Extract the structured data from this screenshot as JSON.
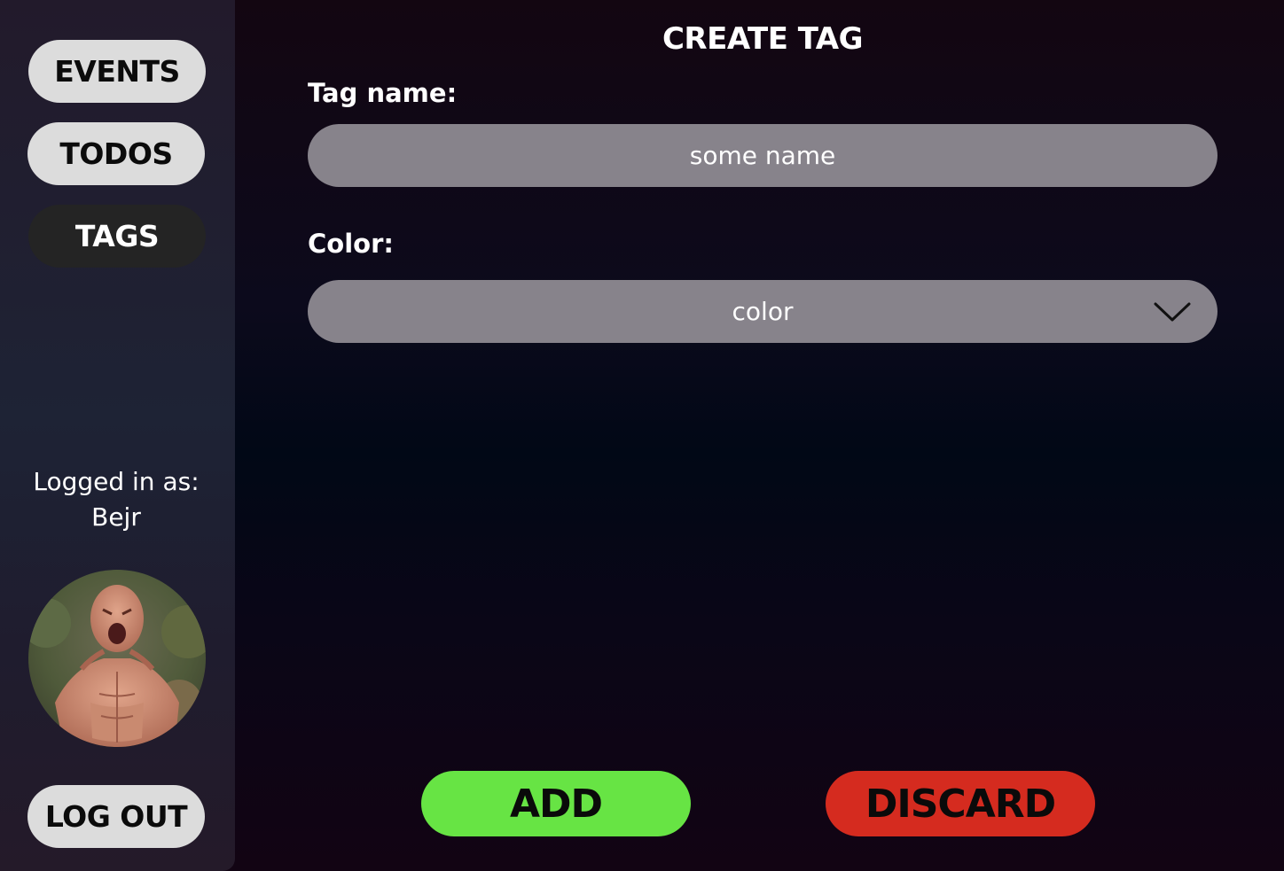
{
  "sidebar": {
    "nav": [
      {
        "label": "EVENTS",
        "active": false
      },
      {
        "label": "TODOS",
        "active": false
      },
      {
        "label": "TAGS",
        "active": true
      }
    ],
    "logged_in_label": "Logged in as:",
    "username": "Bejr",
    "logout_label": "LOG OUT"
  },
  "form": {
    "title": "CREATE TAG",
    "tag_name_label": "Tag name:",
    "tag_name_placeholder": "some name",
    "tag_name_value": "",
    "color_label": "Color:",
    "color_selected": "color",
    "add_label": "ADD",
    "discard_label": "DISCARD"
  },
  "colors": {
    "add": "#67e444",
    "discard": "#d52b1f",
    "field": "#87838b",
    "nav_light": "#dcdcdc",
    "nav_active": "#242424"
  },
  "icons": {
    "select_chevron": "chevron-down-icon",
    "avatar": "user-avatar-photo"
  }
}
